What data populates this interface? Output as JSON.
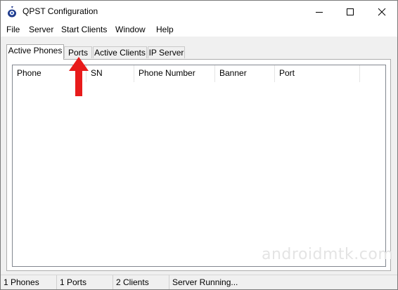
{
  "window": {
    "title": "QPST Configuration",
    "controls": {
      "minimize": "minimize-icon",
      "maximize": "maximize-icon",
      "close": "close-icon"
    }
  },
  "menu": [
    "File",
    "Server",
    "Start Clients",
    "Window",
    "Help"
  ],
  "tabs": [
    {
      "label": "Active Phones",
      "active": true
    },
    {
      "label": "Ports",
      "active": false
    },
    {
      "label": "Active Clients",
      "active": false
    },
    {
      "label": "IP Server",
      "active": false
    }
  ],
  "table": {
    "columns": [
      "Phone",
      "SN",
      "Phone Number",
      "Banner",
      "Port"
    ],
    "rows": []
  },
  "status": [
    "1 Phones",
    "1 Ports",
    "2 Clients",
    "Server Running..."
  ],
  "watermark": "androidmtk.com",
  "annotation": {
    "type": "red-arrow-up",
    "color": "#e81b1b"
  }
}
